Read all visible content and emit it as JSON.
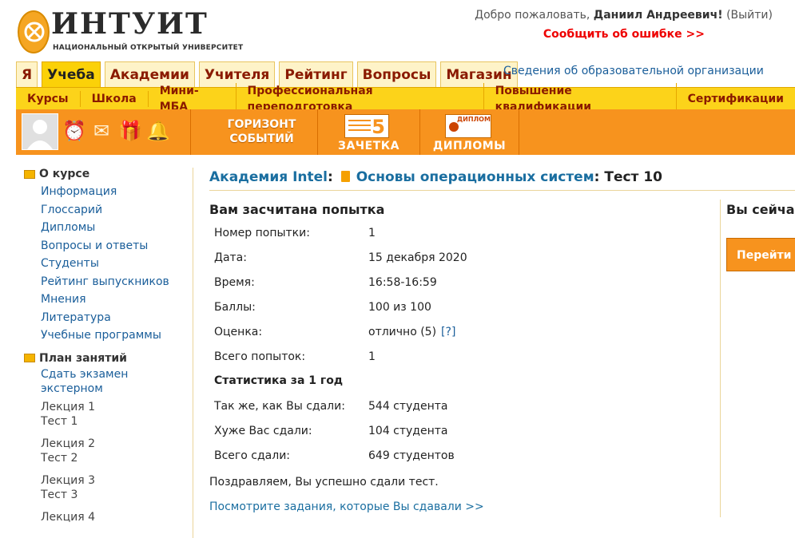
{
  "brand": {
    "name": "ИНТУИТ",
    "subtitle": "НАЦИОНАЛЬНЫЙ ОТКРЫТЫЙ УНИВЕРСИТЕТ"
  },
  "user": {
    "greeting": "Добро пожаловать,",
    "name": "Даниил Андреевич",
    "excl": "!",
    "logout": "(Выйти)"
  },
  "report_error": "Сообщить об ошибке >>",
  "tabs": [
    "Я",
    "Учеба",
    "Академии",
    "Учителя",
    "Рейтинг",
    "Вопросы",
    "Магазин"
  ],
  "edu_info": "Сведения об образовательной организации",
  "subnav": [
    "Курсы",
    "Школа",
    "Мини-МБА",
    "Профессиональная переподготовка",
    "Повышение квалификации",
    "Сертификации"
  ],
  "toolbar": {
    "horizon_line1": "ГОРИЗОНТ",
    "horizon_line2": "СОБЫТИЙ",
    "gradebook": "ЗАЧЕТКА",
    "gradebook_digit": "5",
    "diplomas": "ДИПЛОМЫ",
    "diploma_badge": "ДИПЛОМ"
  },
  "sidebar": {
    "about_title": "О курсе",
    "about_links": [
      "Информация",
      "Глоссарий",
      "Дипломы",
      "Вопросы и ответы",
      "Студенты",
      "Рейтинг выпускников",
      "Мнения",
      "Литература",
      "Учебные программы"
    ],
    "plan_title": "План занятий",
    "exam_link_1": "Сдать экзамен",
    "exam_link_2": "экстерном",
    "lectures": [
      {
        "lecture": "Лекция 1",
        "test": "Тест 1"
      },
      {
        "lecture": "Лекция 2",
        "test": "Тест 2"
      },
      {
        "lecture": "Лекция 3",
        "test": "Тест 3"
      },
      {
        "lecture": "Лекция 4",
        "test": ""
      }
    ]
  },
  "breadcrumb": {
    "academy": "Академия Intel",
    "course": "Основы операционных систем",
    "test": "Тест 10",
    "sep": ":"
  },
  "result": {
    "title": "Вам засчитана попытка",
    "rows": [
      {
        "k": "Номер попытки:",
        "v": "1"
      },
      {
        "k": "Дата:",
        "v": "15 декабря 2020"
      },
      {
        "k": "Время:",
        "v": "16:58-16:59"
      },
      {
        "k": "Баллы:",
        "v": "100 из 100"
      },
      {
        "k": "Оценка:",
        "v": "отлично (5)",
        "help": "[?]"
      },
      {
        "k": "Всего попыток:",
        "v": "1"
      }
    ],
    "stats_title": "Статистика за 1 год",
    "stats": [
      {
        "k": "Так же, как Вы сдали:",
        "v": "544 студента"
      },
      {
        "k": "Хуже Вас сдали:",
        "v": "104 студента"
      },
      {
        "k": "Всего сдали:",
        "v": "649 студентов"
      }
    ],
    "congrats": "Поздравляем, Вы успешно сдали тест.",
    "view_link": "Посмотрите задания, которые Вы сдавали >>"
  },
  "right_panel": {
    "title": "Вы сейча",
    "button": "Перейти к"
  }
}
